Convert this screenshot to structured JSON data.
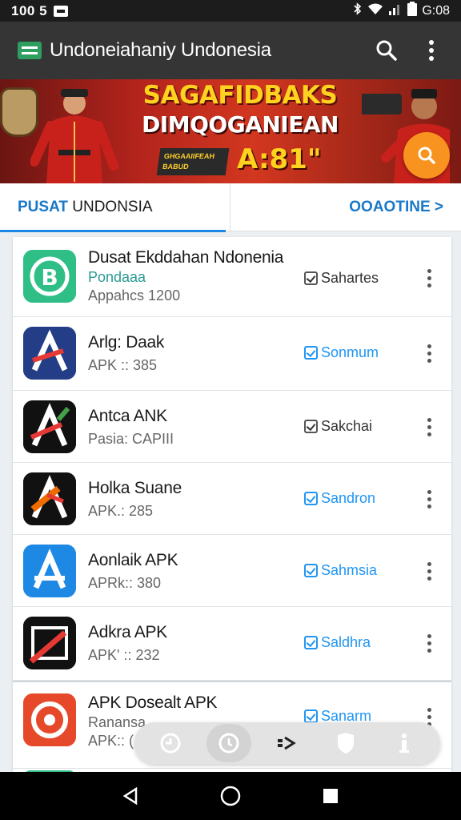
{
  "status_bar": {
    "time": "100 5",
    "battery": "G:08"
  },
  "app_bar": {
    "title": "Undoneiahaniy Undonesia"
  },
  "banner": {
    "headline_1": "SAGAFIDBAKS",
    "headline_2": "DIMQOGANIEAN",
    "sub_1": "GHGAAIIFEAH",
    "sub_2": "BABUD",
    "big_text": "A:81\""
  },
  "tabs": {
    "left_prefix": "PUSAT",
    "left_label": "UNDONSIA",
    "right_label": "OOAOTINE >"
  },
  "apps": [
    {
      "name": "Dusat Ekddahan Ndonenia",
      "dev": "Pondaaa",
      "meta": "Appahcs 1200",
      "action": "Sahartes",
      "action_color": "#333333"
    },
    {
      "name": "Arlg: Daak",
      "dev": "",
      "meta": "APK :: 385",
      "action": "Sonmum",
      "action_color": "#2196f3"
    },
    {
      "name": "Antca ANK",
      "dev": "",
      "meta": "Pasia: CAPIII",
      "action": "Sakchai",
      "action_color": "#333333"
    },
    {
      "name": "Holka Suane",
      "dev": "",
      "meta": "APK.: 285",
      "action": "Sandron",
      "action_color": "#2196f3"
    },
    {
      "name": "Aonlaik APK",
      "dev": "",
      "meta": "APRk:: 380",
      "action": "Sahmsia",
      "action_color": "#2196f3"
    },
    {
      "name": "Adkra APK",
      "dev": "",
      "meta": "APK' :: 232",
      "action": "Saldhra",
      "action_color": "#2196f3"
    },
    {
      "name": "APK Dosealt APK",
      "dev": "Ranansa",
      "meta": "APK:: (",
      "action": "Sanarm",
      "action_color": "#2196f3"
    }
  ],
  "colors": {
    "app_bar": "#353535",
    "accent_blue": "#1e88e5",
    "fab": "#f7931e",
    "teal": "#2a9a95"
  }
}
